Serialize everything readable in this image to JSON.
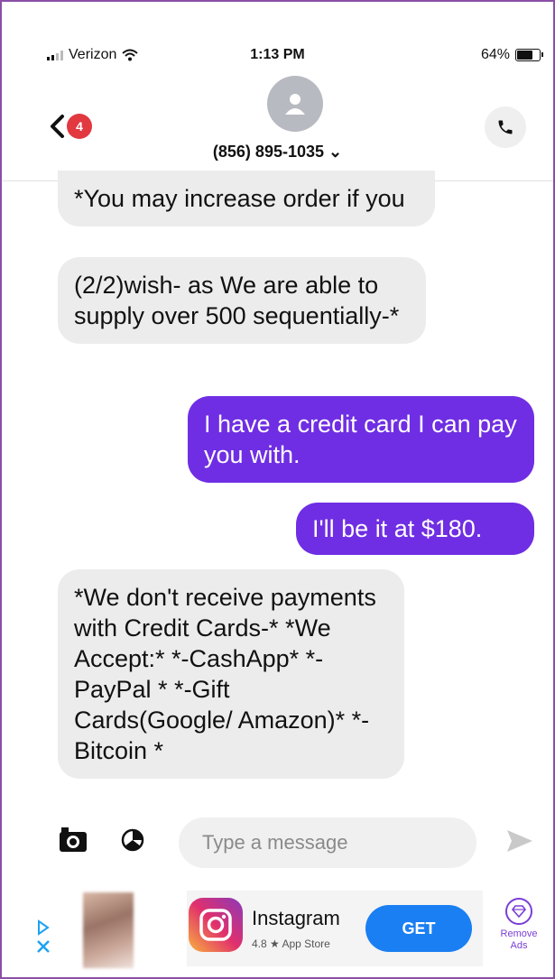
{
  "status": {
    "carrier": "Verizon",
    "time": "1:13 PM",
    "battery": "64%"
  },
  "header": {
    "unread_count": "4",
    "contact": "(856) 895-1035 ⌄"
  },
  "messages": [
    {
      "direction": "in",
      "text": "*You may increase order if you"
    },
    {
      "direction": "in",
      "text": "(2/2)wish- as We are able to supply over 500 sequentially-*"
    },
    {
      "direction": "out",
      "text": "I have a credit card I can pay you with."
    },
    {
      "direction": "out",
      "text": "I'll be it at $180."
    },
    {
      "direction": "in",
      "text": "*We don't receive payments with Credit Cards-* *We Accept:* *-CashApp* *-PayPal * *-Gift Cards(Google/ Amazon)* *-Bitcoin *"
    }
  ],
  "composer": {
    "placeholder": "Type a message"
  },
  "ad": {
    "app_name": "Instagram",
    "rating": "4.8 ★ App Store",
    "cta": "GET",
    "remove_ads": "Remove Ads"
  },
  "colors": {
    "outgoing": "#6f2ee3",
    "incoming": "#ececec",
    "accent": "#1a7ff2",
    "badge": "#e2383f"
  },
  "icons": [
    "signal-icon",
    "wifi-icon",
    "battery-icon",
    "back-chevron-icon",
    "person-icon",
    "phone-icon",
    "camera-icon",
    "sticker-icon",
    "send-icon",
    "adchoices-icon",
    "close-icon",
    "instagram-icon",
    "gem-icon"
  ]
}
